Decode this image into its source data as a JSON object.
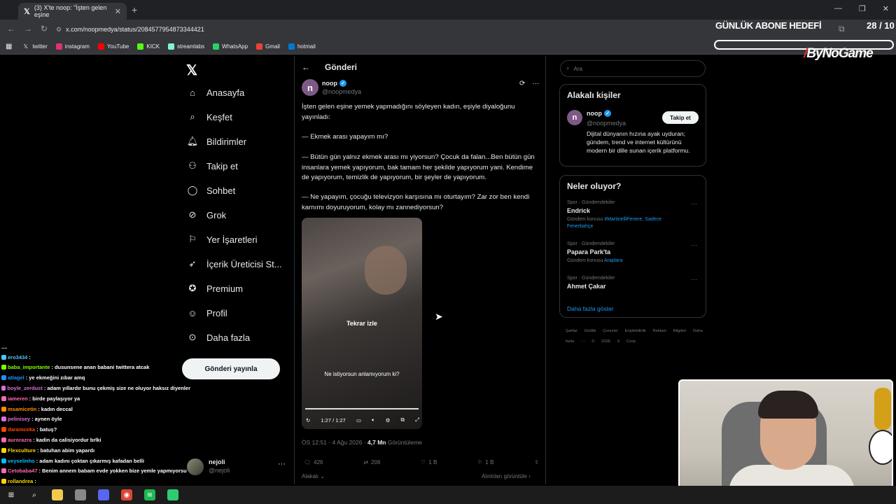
{
  "browser": {
    "tab_title": "(3) X'te noop: \"İşten gelen eşine",
    "url": "x.com/noopmedya/status/2084577954873344421",
    "bookmarks": [
      {
        "label": "twitter",
        "icon": "x-icon",
        "color": "#000000"
      },
      {
        "label": "instagram",
        "icon": "instagram-icon",
        "color": "#e1306c"
      },
      {
        "label": "YouTube",
        "icon": "youtube-icon",
        "color": "#ff0000"
      },
      {
        "label": "KICK",
        "icon": "kick-icon",
        "color": "#53fc18"
      },
      {
        "label": "streamlabs",
        "icon": "streamlabs-icon",
        "color": "#80f5d2"
      },
      {
        "label": "WhatsApp",
        "icon": "whatsapp-icon",
        "color": "#25d366"
      },
      {
        "label": "Gmail",
        "icon": "gmail-icon",
        "color": "#ea4335"
      },
      {
        "label": "hotmail",
        "icon": "hotmail-icon",
        "color": "#0078d4"
      }
    ]
  },
  "overlay": {
    "sub_goal_label": "GÜNLÜK ABONE HEDEFİ",
    "sub_goal_count": "28 / 10",
    "brand": "ByNoGame"
  },
  "nav": {
    "items": [
      {
        "label": "Anasayfa",
        "icon": "home-icon"
      },
      {
        "label": "Keşfet",
        "icon": "search-icon"
      },
      {
        "label": "Bildirimler",
        "icon": "bell-icon"
      },
      {
        "label": "Takip et",
        "icon": "add-person-icon"
      },
      {
        "label": "Sohbet",
        "icon": "chat-bubble-icon"
      },
      {
        "label": "Grok",
        "icon": "grok-icon"
      },
      {
        "label": "Yer İşaretleri",
        "icon": "bookmark-icon"
      },
      {
        "label": "İçerik Üreticisi St...",
        "icon": "rocket-icon"
      },
      {
        "label": "Premium",
        "icon": "verified-badge-icon"
      },
      {
        "label": "Profil",
        "icon": "person-icon"
      },
      {
        "label": "Daha fazla",
        "icon": "more-circle-icon"
      }
    ],
    "post_button": "Gönderi yayınla",
    "account": {
      "name": "nejoli",
      "handle": "@nejoli"
    }
  },
  "tweet": {
    "page_title": "Gönderi",
    "avatar_letter": "n",
    "name": "noop",
    "handle": "@noopmedya",
    "paragraphs": [
      "İşten gelen eşine yemek yapmadığını söyleyen kadın, eşiyle diyaloğunu yayınladı:",
      "— Ekmek arası yapayım mı?",
      "— Bütün gün yalnız ekmek arası mı yiyorsun? Çocuk da falan...Ben bütün gün insanlara yemek yapıyorum, bak tamam her şekilde yapıyorum yani. Kendime de yapıyorum, temizlik de yapıyorum, bir şeyler de yapıyorum.",
      "— Ne yapayım, çocuğu televizyon karşısına mı oturtayım? Zar zor ben kendi karnımı doyuruyorum, kolay mı zannediyorsun?"
    ],
    "video": {
      "replay_label": "Tekrar izle",
      "subtitle": "Ne istiyorsun anlamıyorum ki?",
      "time": "1:27 / 1:27"
    },
    "meta_time": "ÖS 12:51 · 4 Ağu 2026 · ",
    "views_count": "4,7 Mn",
    "views_label": " Görüntüleme",
    "replies": "426",
    "reposts": "206",
    "likes": "1 B",
    "bookmarks": "1 B",
    "relevant_label": "Alakalı",
    "quotes_label": "Alıntıları görüntüle ›"
  },
  "sidebar": {
    "search_placeholder": "Ara",
    "relevant_people": {
      "title": "Alakalı kişiler",
      "name": "noop",
      "handle": "@noopmedya",
      "follow_button": "Takip et",
      "bio": "Dijital dünyanın hızına ayak uyduran; gündem, trend ve internet kültürünü modern bir dille sunan içerik platformu."
    },
    "trends": {
      "title": "Neler oluyor?",
      "items": [
        {
          "category": "Spor · Gündemdekiler",
          "name": "Endrick",
          "context_prefix": "Gündem konusu ",
          "context_tags": "#MartinelliFenere, Sadece Fenerbahçe"
        },
        {
          "category": "Spor · Gündemdekiler",
          "name": "Papara Park'ta",
          "context_prefix": "Gündem konusu ",
          "context_tags": "Araplara"
        },
        {
          "category": "Spor · Gündemdekiler",
          "name": "Ahmet Çakar",
          "context_prefix": "",
          "context_tags": ""
        }
      ],
      "show_more": "Daha fazla göster"
    },
    "footer": "Şartlar Gizlilik Çerezler Erişilebilirlik Reklam Bilgileri Daha fazla ··· © 2026 X Corp."
  },
  "chat": {
    "messages": [
      {
        "user": "ero3434",
        "color": "#4fc3f7",
        "text": ""
      },
      {
        "user": "baba_importante",
        "color": "#7fff00",
        "text": "dusunsene anan babani twittera atcak"
      },
      {
        "user": "atlagel",
        "color": "#1e90ff",
        "text": "ye ekmeğini zıbar amq"
      },
      {
        "user": "boyle_zerdust",
        "color": "#da70d6",
        "text": "adam yıllardır bunu çekmiş size ne oluyor haksız diyenler"
      },
      {
        "user": "iameren",
        "color": "#ff69b4",
        "text": "birde paylaşıyor ya"
      },
      {
        "user": "msamicetin",
        "color": "#ff8c00",
        "text": "kadın deccal"
      },
      {
        "user": "pelinisey",
        "color": "#da70d6",
        "text": "aynen öyle"
      },
      {
        "user": "daramceka",
        "color": "#ff4500",
        "text": "batuş?"
      },
      {
        "user": "aurorazra",
        "color": "#ff69b4",
        "text": "kadin da calisiyordur brlki"
      },
      {
        "user": "Flexculture",
        "color": "#ffd700",
        "text": "batuhan abim yapardı"
      },
      {
        "user": "veyselinho",
        "color": "#00bfff",
        "text": "adam kadını çoktan çıkarmış kafadan belli"
      },
      {
        "user": "Cetobaba47",
        "color": "#ff69b4",
        "text": "Benim annem babam evde yokken bize yemle yapmıyorsu"
      },
      {
        "user": "rollandrea",
        "color": "#ffd700",
        "text": ""
      }
    ]
  },
  "taskbar": {
    "apps": [
      "windows-icon",
      "search-icon",
      "file-explorer-icon",
      "app-icon",
      "discord-icon",
      "chrome-icon",
      "spotify-icon",
      "app-green-icon"
    ]
  }
}
